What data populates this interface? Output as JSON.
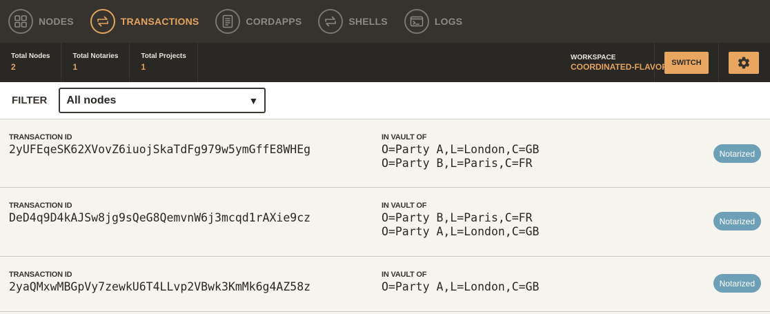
{
  "nav": {
    "items": [
      {
        "label": "NODES",
        "icon": "grid-icon",
        "active": false
      },
      {
        "label": "TRANSACTIONS",
        "icon": "transfer-arrows-icon",
        "active": true
      },
      {
        "label": "CORDAPPS",
        "icon": "document-icon",
        "active": false
      },
      {
        "label": "SHELLS",
        "icon": "transfer-arrows-icon",
        "active": false
      },
      {
        "label": "LOGS",
        "icon": "terminal-icon",
        "active": false
      }
    ]
  },
  "stats": [
    {
      "label": "Total Nodes",
      "value": "2"
    },
    {
      "label": "Total Notaries",
      "value": "1"
    },
    {
      "label": "Total Projects",
      "value": "1"
    }
  ],
  "workspace": {
    "label": "WORKSPACE",
    "value": "COORDINATED-FLAVOR"
  },
  "toolbar": {
    "switch_label": "SWITCH",
    "settings_icon": "gear-icon"
  },
  "filter": {
    "label": "FILTER",
    "selected": "All nodes"
  },
  "transactions": {
    "id_header": "TRANSACTION ID",
    "vault_header": "IN VAULT OF",
    "rows": [
      {
        "id": "2yUFEqeSK62XVovZ6iuojSkaTdFg979w5ymGffE8WHEg",
        "vault": [
          "O=Party A,L=London,C=GB",
          "O=Party B,L=Paris,C=FR"
        ],
        "status": "Notarized"
      },
      {
        "id": "DeD4q9D4kAJSw8jg9sQeG8QemvnW6j3mcqd1rAXie9cz",
        "vault": [
          "O=Party B,L=Paris,C=FR",
          "O=Party A,L=London,C=GB"
        ],
        "status": "Notarized"
      },
      {
        "id": "2yaQMxwMBGpVy7zewkU6T4LLvp2VBwk3KmMk6g4AZ58z",
        "vault": [
          "O=Party A,L=London,C=GB"
        ],
        "status": "Notarized"
      }
    ]
  },
  "colors": {
    "accent": "#e3a45f",
    "nav_bg": "#36332f",
    "stats_bg": "#2a2825",
    "badge": "#6d9fb6"
  }
}
